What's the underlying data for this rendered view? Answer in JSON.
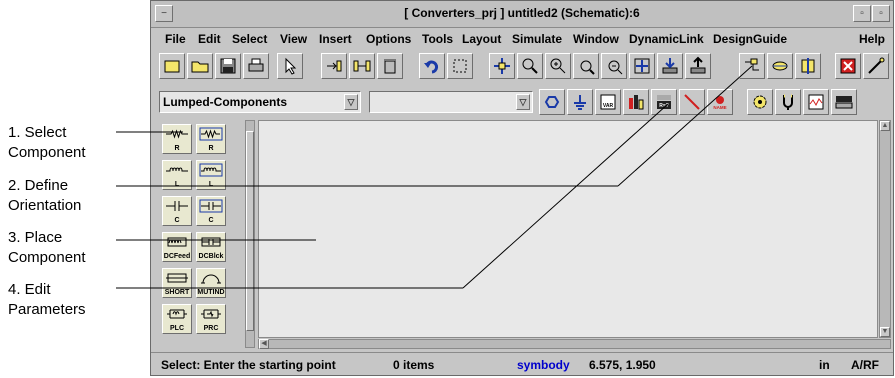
{
  "annotations": [
    {
      "text": "1. Select\nComponent"
    },
    {
      "text": "2. Define\nOrientation"
    },
    {
      "text": "3. Place\nComponent"
    },
    {
      "text": "4. Edit\nParameters"
    }
  ],
  "window": {
    "title": "[ Converters_prj ] untitled2 (Schematic):6",
    "title_controls": [
      "−",
      "▫",
      "▫"
    ]
  },
  "menu": [
    "File",
    "Edit",
    "Select",
    "View",
    "Insert",
    "Options",
    "Tools",
    "Layout",
    "Simulate",
    "Window",
    "DynamicLink",
    "DesignGuide",
    "Help"
  ],
  "toolbar_icons": [
    "new-file-icon",
    "open-folder-icon",
    "save-icon",
    "print-icon",
    "pointer-icon",
    "insert-pin-icon",
    "insert-ports-icon",
    "delete-icon",
    "undo-icon",
    "rotate-dashed-icon",
    "move-icon",
    "zoom-area-icon",
    "zoom-in-icon",
    "zoom-point-icon",
    "zoom-out-icon",
    "view-all-icon",
    "push-into-icon",
    "pop-out-icon",
    "wire-icon",
    "rotate-icon",
    "mirror-icon",
    "stop-icon",
    "tune-icon"
  ],
  "library": {
    "value": "Lumped-Components",
    "dropdown_arrow": "▽"
  },
  "component_combo": {
    "value": "",
    "dropdown_arrow": "▽"
  },
  "tool_row2": [
    {
      "icon": "port-icon",
      "label": ""
    },
    {
      "icon": "ground-icon",
      "label": ""
    },
    {
      "icon": "var-icon",
      "label": "VAR"
    },
    {
      "icon": "component-lib-icon",
      "label": ""
    },
    {
      "icon": "parameters-icon",
      "label": "R=?"
    },
    {
      "icon": "wire-draw-icon",
      "label": ""
    },
    {
      "icon": "name-icon",
      "label": "NAME"
    },
    {
      "icon": "simulate-gear-icon",
      "label": ""
    },
    {
      "icon": "tuning-fork-icon",
      "label": ""
    },
    {
      "icon": "data-display-icon",
      "label": ""
    },
    {
      "icon": "sweep-plan-icon",
      "label": ""
    }
  ],
  "palette": [
    {
      "label": "R",
      "icon": "resistor-icon"
    },
    {
      "label": "R",
      "icon": "resistor-box-icon"
    },
    {
      "label": "L",
      "icon": "inductor-icon"
    },
    {
      "label": "L",
      "icon": "inductor-box-icon"
    },
    {
      "label": "C",
      "icon": "capacitor-icon"
    },
    {
      "label": "C",
      "icon": "capacitor-box-icon"
    },
    {
      "label": "DCFeed",
      "icon": "dcfeed-icon"
    },
    {
      "label": "DCBlck",
      "icon": "dcblock-icon"
    },
    {
      "label": "SHORT",
      "icon": "short-icon"
    },
    {
      "label": "MUTIND",
      "icon": "mutind-icon"
    },
    {
      "label": "PLC",
      "icon": "plc-icon"
    },
    {
      "label": "PRC",
      "icon": "prc-icon"
    }
  ],
  "status": {
    "message": "Select: Enter the starting point",
    "items": "0 items",
    "mode": "symbody",
    "coords": "6.575, 1.950",
    "unit": "in",
    "product": "A/RF"
  },
  "colors": {
    "accent_mode": "#0000cc",
    "leader": "#000000"
  }
}
